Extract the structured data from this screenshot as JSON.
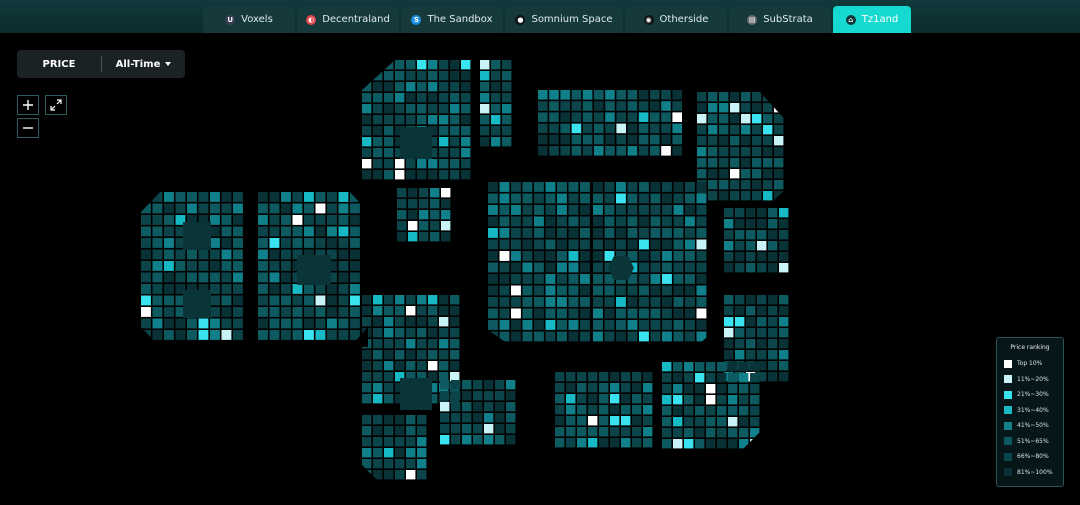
{
  "tabs": [
    {
      "label": "Voxels",
      "icon": "voxels-icon",
      "icon_char": "U",
      "icon_color": "#3b3f52",
      "active": false
    },
    {
      "label": "Decentraland",
      "icon": "decentraland-icon",
      "icon_char": "◐",
      "icon_color": "#e0454b",
      "active": false
    },
    {
      "label": "The Sandbox",
      "icon": "sandbox-icon",
      "icon_char": "S",
      "icon_color": "#1d8fe0",
      "active": false
    },
    {
      "label": "Somnium Space",
      "icon": "somnium-icon",
      "icon_char": "●",
      "icon_color": "#111111",
      "active": false
    },
    {
      "label": "Otherside",
      "icon": "otherside-icon",
      "icon_char": "◉",
      "icon_color": "#111111",
      "active": false
    },
    {
      "label": "SubStrata",
      "icon": "substrata-icon",
      "icon_char": "▤",
      "icon_color": "#6a6a6a",
      "active": false
    },
    {
      "label": "Tz1and",
      "icon": "tz1and-icon",
      "icon_char": "⌂",
      "icon_color": "#0b3a38",
      "active": true
    }
  ],
  "filter": {
    "metric": "PRICE",
    "period": "All-Time"
  },
  "legend": {
    "title": "Price ranking",
    "items": [
      {
        "label": "Top 10%",
        "color": "#ffffff"
      },
      {
        "label": "11%~20%",
        "color": "#c8f4f7"
      },
      {
        "label": "21%~30%",
        "color": "#3ae3ef"
      },
      {
        "label": "31%~40%",
        "color": "#16b9c4"
      },
      {
        "label": "41%~50%",
        "color": "#10808a"
      },
      {
        "label": "51%~65%",
        "color": "#0d5a60"
      },
      {
        "label": "66%~80%",
        "color": "#0b4449"
      },
      {
        "label": "81%~100%",
        "color": "#083236"
      }
    ]
  }
}
